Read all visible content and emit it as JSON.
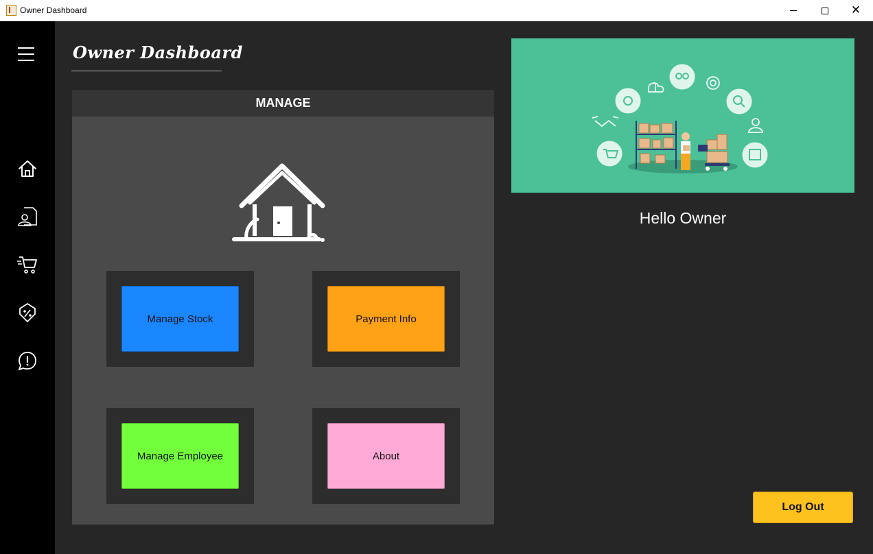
{
  "window": {
    "title": "Owner Dashboard"
  },
  "sidebar": {
    "items": [
      {
        "icon": "menu-icon"
      },
      {
        "icon": "home-icon"
      },
      {
        "icon": "user-profile-icon"
      },
      {
        "icon": "cart-icon"
      },
      {
        "icon": "discount-tag-icon"
      },
      {
        "icon": "alert-icon"
      }
    ]
  },
  "main": {
    "heading": "Owner Dashboard",
    "panel_title": "MANAGE",
    "buttons": {
      "manage_stock": "Manage Stock",
      "payment_info": "Payment Info",
      "manage_employee": "Manage Employee",
      "about": "About"
    }
  },
  "right": {
    "greeting": "Hello Owner",
    "logout": "Log Out"
  },
  "colors": {
    "manage_stock": "#1a86ff",
    "payment_info": "#ffa216",
    "manage_employee": "#72ff3c",
    "about": "#ffaad6",
    "logout": "#fdc21e",
    "banner": "#4cc197"
  }
}
